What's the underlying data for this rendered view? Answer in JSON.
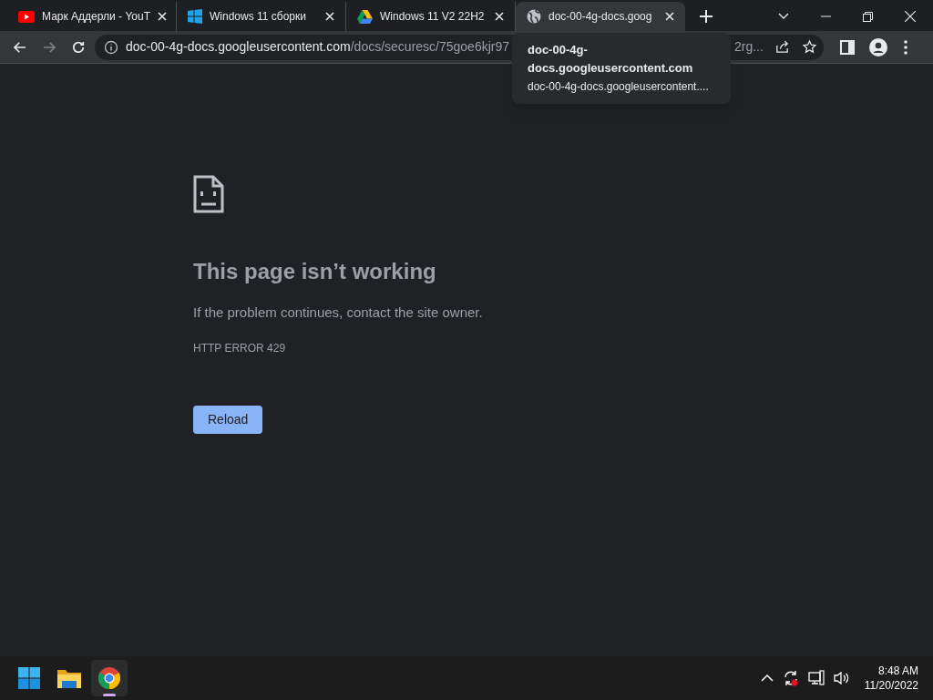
{
  "tabs": [
    {
      "title": "Марк Аддерли - YouT",
      "kind": "youtube",
      "selected": false
    },
    {
      "title": "Windows 11 сборки",
      "kind": "windows",
      "selected": false
    },
    {
      "title": "Windows 11 V2 22H2",
      "kind": "drive",
      "selected": false
    },
    {
      "title": "doc-00-4g-docs.goog",
      "kind": "globe",
      "selected": true
    }
  ],
  "address_bar": {
    "host": "doc-00-4g-docs.googleusercontent.com",
    "path": "/docs/securesc/75goe6kjr97",
    "tail": "2rg..."
  },
  "tooltip": {
    "title": "doc-00-4g-docs.googleusercontent.com",
    "url": "doc-00-4g-docs.googleusercontent...."
  },
  "error_page": {
    "heading": "This page isn’t working",
    "message": "If the problem continues, contact the site owner.",
    "code": "HTTP ERROR 429",
    "button": "Reload"
  },
  "taskbar": {
    "apps": [
      {
        "kind": "start",
        "active": false
      },
      {
        "kind": "files",
        "active": false
      },
      {
        "kind": "chrome",
        "active": true
      }
    ],
    "time": "8:48 AM",
    "date": "11/20/2022"
  }
}
